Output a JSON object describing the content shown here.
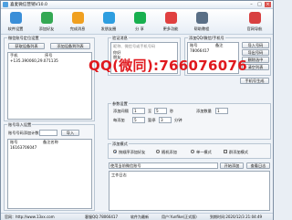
{
  "window": {
    "title": "喜麦微信营销V10.0"
  },
  "toolbar": [
    {
      "label": "软件设置",
      "color": "#3b8fd8",
      "icon": "gear-icon"
    },
    {
      "label": "添加好友",
      "color": "#34a853",
      "icon": "add-user-icon"
    },
    {
      "label": "完成消息",
      "color": "#f0a020",
      "icon": "message-icon"
    },
    {
      "label": "发朋友圈",
      "color": "#2e9ee0",
      "icon": "camera-icon"
    },
    {
      "label": "分 享",
      "color": "#18b04f",
      "icon": "share-icon"
    },
    {
      "label": "更多功能",
      "color": "#e04040",
      "icon": "more-icon"
    },
    {
      "label": "帮助教程",
      "color": "#5a6f86",
      "icon": "help-icon"
    },
    {
      "label": "官网导航",
      "color": "#d84040",
      "icon": "home-icon"
    }
  ],
  "device_panel": {
    "legend": "微信账号定位设置",
    "get_button": "获取设备列表",
    "add_button": "添加设备到列表",
    "col1": "手机",
    "col2": "序号",
    "row": "+135.390060,29.071135"
  },
  "greeting_panel": {
    "legend": "验证消息",
    "placeholder": "昵称、微信号或手机号码",
    "lines": [
      "你好",
      "朋友"
    ]
  },
  "phone_panel": {
    "legend": "添加QQ/微信/手机号",
    "col1": "账号",
    "col2": "备注",
    "row": "78066417",
    "buttons": [
      "导入号码",
      "导出号码",
      "删除选中",
      "清空列表"
    ],
    "gen_button": "手机号生成"
  },
  "watermark": "QQ(微同):766076076",
  "import_panel": {
    "legend": "账号导入设置",
    "label": "账号号码添加计数",
    "button": "导入",
    "col1": "账号",
    "col2": "备注名称",
    "row": "16163706047"
  },
  "params": {
    "legend": "参数设置",
    "interval_label": "添加间隔",
    "interval_value": "1",
    "to_label": "至",
    "interval_max": "5",
    "sec_label": "秒",
    "count_label": "添加数量",
    "count_value": "1",
    "gap_label": "每添加",
    "gap_value": "5",
    "pause_label": "暂停",
    "pause_value": "3",
    "pause_unit": "分钟"
  },
  "mode": {
    "legend": "添加模式",
    "options": [
      "按顺序添加好友",
      "随机添加",
      "单一模式",
      "群添加模式"
    ]
  },
  "run": {
    "select": "使用当前微信账号",
    "start": "开始添加",
    "stop": "查看日志",
    "log_label": "工作日志"
  },
  "status": {
    "site": "官网：http://www.13xx.com",
    "qq": "客服QQ:78066417",
    "version": "软件为最新",
    "account": "用户:Yunfike(正式版)",
    "expire": "到期时间:2020/12/3 21:04:49"
  }
}
